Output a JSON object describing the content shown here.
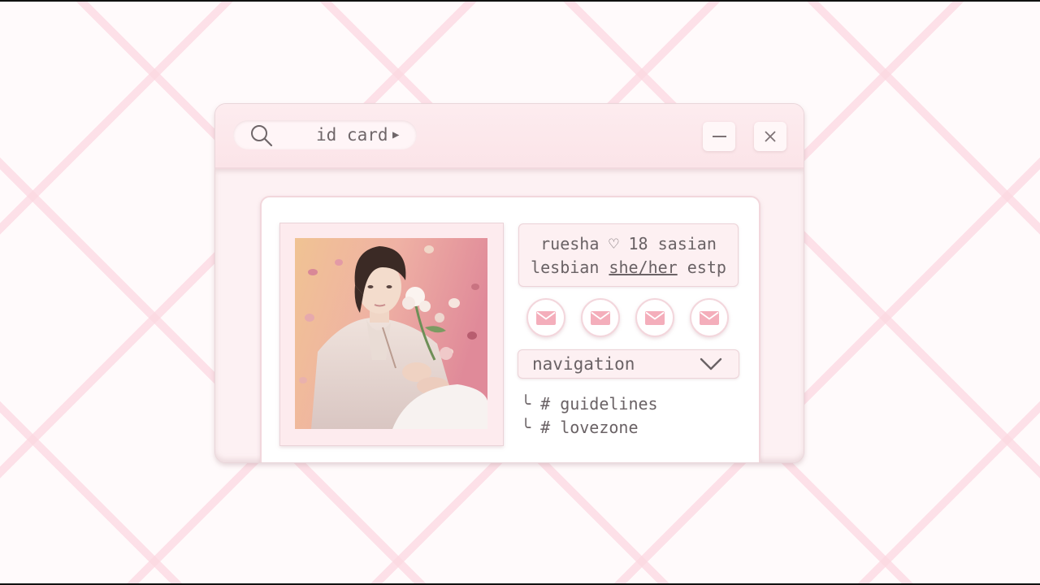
{
  "window": {
    "title": "id card",
    "icons": {
      "search": "search-icon",
      "play": "play-icon",
      "minimize": "minimize-icon",
      "close": "close-icon"
    }
  },
  "profile": {
    "line1": "ruesha ♡ 18 sasian",
    "line2_prefix": "lesbian ",
    "pronouns": "she/her",
    "line2_suffix": " estp",
    "photo": "portrait-photo"
  },
  "contact_icons": [
    "mail-icon",
    "mail-icon",
    "mail-icon",
    "mail-icon"
  ],
  "navigation": {
    "label": "navigation",
    "icon": "chevron-down-icon",
    "channels": [
      {
        "branch": "╰",
        "prefix": "#",
        "name": "guidelines"
      },
      {
        "branch": "╰",
        "prefix": "#",
        "name": "lovezone"
      }
    ]
  },
  "colors": {
    "accent": "#f4aebb",
    "window_bg": "#fdf1f3",
    "text": "#6a6265"
  }
}
